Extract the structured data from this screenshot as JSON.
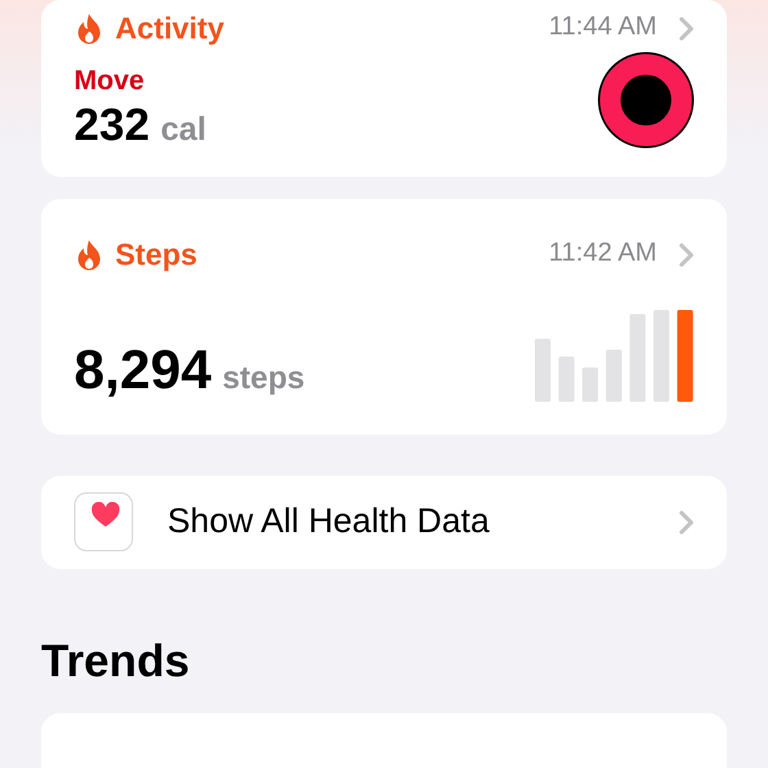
{
  "activity": {
    "title": "Activity",
    "time": "11:44 AM",
    "metric": "Move",
    "value": "232",
    "unit": "cal"
  },
  "steps": {
    "title": "Steps",
    "time": "11:42 AM",
    "value": "8,294",
    "unit": "steps"
  },
  "show_all": {
    "label": "Show All Health Data"
  },
  "trends": {
    "heading": "Trends"
  }
}
